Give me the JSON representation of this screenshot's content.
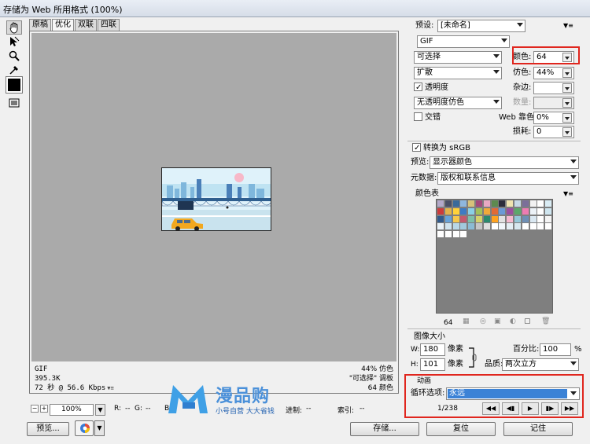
{
  "window": {
    "title": "存储为 Web 所用格式 (100%)"
  },
  "view_tabs": [
    "原稿",
    "优化",
    "双联",
    "四联"
  ],
  "image_info": {
    "format": "GIF",
    "size": "395.3K",
    "download": "72 秒 @ 56.6 Kbps",
    "dither_info": "44% 仿色",
    "palette_info": "\"可选择\" 调板",
    "colors_info": "64 颜色"
  },
  "statusbar": {
    "zoom": "100%",
    "r_label": "R:",
    "r_value": "--",
    "g_label": "G:",
    "g_value": "--",
    "b_label": "B",
    "hex_label": "进制:",
    "hex_value": "--",
    "index_label": "索引:",
    "index_value": "--"
  },
  "watermark": {
    "title": "漫品购",
    "subtitle": "小号自营 大大省钱"
  },
  "buttons": {
    "preview": "预览...",
    "save": "存储...",
    "reset": "复位",
    "remember": "记住"
  },
  "settings": {
    "preset_label": "预设:",
    "preset_value": "[未命名]",
    "format": "GIF",
    "reduction": "可选择",
    "colors_label": "颜色:",
    "colors_value": "64",
    "dither_algo": "扩散",
    "dither_label": "仿色:",
    "dither_value": "44%",
    "transparency_label": "透明度",
    "matte_label": "杂边:",
    "matte_value": "",
    "transparency_dither": "无透明度仿色",
    "amount_label": "数量:",
    "amount_value": "",
    "interlaced_label": "交错",
    "web_snap_label": "Web 靠色:",
    "web_snap_value": "0%",
    "lossy_label": "损耗:",
    "lossy_value": "0",
    "convert_srgb_label": "转换为 sRGB",
    "preview_label": "预览:",
    "preview_value": "显示器颜色",
    "metadata_label": "元数据:",
    "metadata_value": "版权和联系信息"
  },
  "color_table": {
    "title": "颜色表",
    "count": "64",
    "swatches": [
      "#b3a8c9",
      "#4b4f66",
      "#3a6a9a",
      "#8fb7dd",
      "#d7c27a",
      "#a34a7b",
      "#e8a9c2",
      "#5d8a4f",
      "#2c2c3a",
      "#f0e3b0",
      "#c7d9e6",
      "#7b6f99",
      "#f2f2f2",
      "#ffffff",
      "#d9ecf4",
      "#cc3b3b",
      "#e3b44c",
      "#ffd23a",
      "#3c7bc4",
      "#8ad0e6",
      "#a2c15b",
      "#f0a93a",
      "#e06a36",
      "#6b9ad6",
      "#9b4f9f",
      "#5aa86a",
      "#ee7cb2",
      "#ecf2f7",
      "#ffffff",
      "#cfe6f0",
      "#315a8c",
      "#67a3d9",
      "#f6c84b",
      "#c35a6e",
      "#7ec0a8",
      "#d6d16b",
      "#2a8a6e",
      "#ffa21f",
      "#e2e2e2",
      "#f7b9cf",
      "#94c7d8",
      "#6e8fb5",
      "#dae8f2",
      "#ffffff",
      "#f4f4f4",
      "#e9f2f8",
      "#d0e4ef",
      "#b9d7e6",
      "#a2c9dd",
      "#8bbbd4",
      "#c6c6c6",
      "#dedede",
      "#ffffff",
      "#f0f6fa",
      "#e4eef4",
      "#d7e7ef",
      "#ffffff",
      "#ffffff",
      "#ffffff",
      "#ffffff",
      "#ffffff",
      "#ffffff",
      "#ffffff",
      "#ffffff"
    ]
  },
  "image_size": {
    "title": "图像大小",
    "w_label": "W:",
    "w_value": "180",
    "h_label": "H:",
    "h_value": "101",
    "unit": "像素",
    "percent_label": "百分比:",
    "percent_value": "100",
    "percent_unit": "%",
    "quality_label": "品质:",
    "quality_value": "两次立方"
  },
  "animation": {
    "title": "动画",
    "loop_label": "循环选项:",
    "loop_value": "永远",
    "frame": "1/238"
  },
  "colors": {
    "highlight": "#e0261e",
    "canvas_bg": "#aaaaaa",
    "accent": "#3b82d6"
  }
}
